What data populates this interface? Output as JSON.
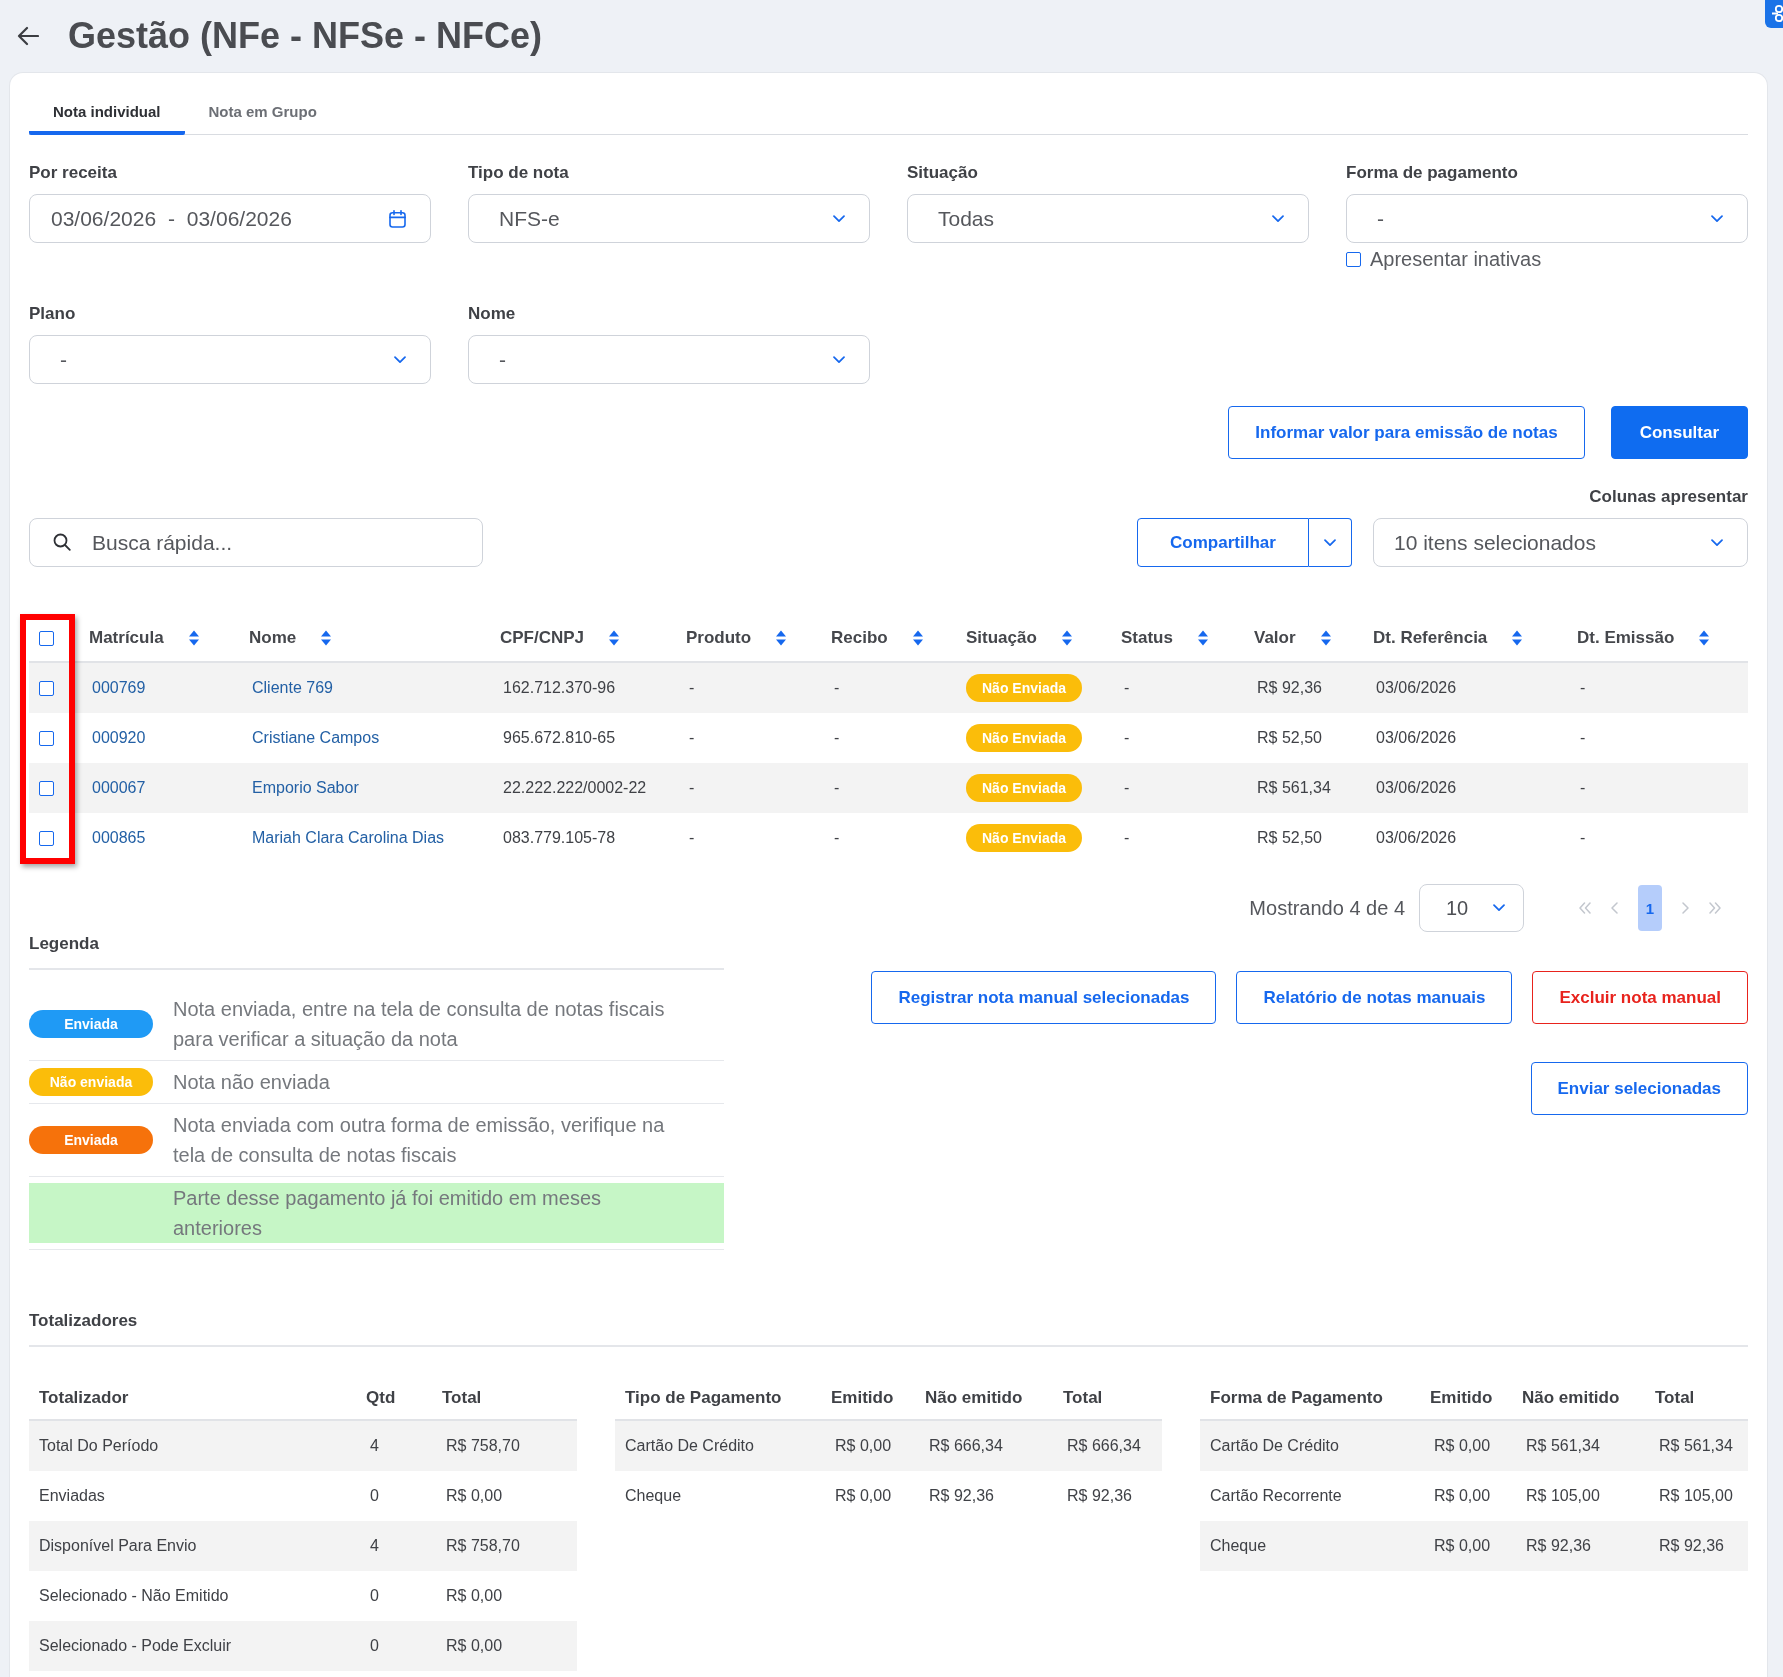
{
  "header": {
    "title": "Gestão (NFe - NFSe - NFCe)"
  },
  "tabs": [
    {
      "label": "Nota individual",
      "selected": true
    },
    {
      "label": "Nota em Grupo",
      "selected": false
    }
  ],
  "filters": [
    {
      "kind": "date-range",
      "label": "Por receita",
      "value": "03/06/2026 - 03/06/2026"
    },
    {
      "kind": "select",
      "label": "Tipo de nota",
      "value": "NFS-e"
    },
    {
      "kind": "select",
      "label": "Situação",
      "value": "Todas"
    },
    {
      "kind": "select",
      "label": "Forma de pagamento",
      "value": "-",
      "checkbox": {
        "label": "Apresentar inativas",
        "checked": false
      }
    },
    {
      "kind": "select",
      "label": "Plano",
      "value": "-"
    },
    {
      "kind": "select",
      "label": "Nome",
      "value": "-"
    }
  ],
  "actions": [
    {
      "label": "Informar valor para emissão de notas",
      "kind": "outline"
    },
    {
      "label": "Consultar",
      "kind": "primary"
    }
  ],
  "toolbar": {
    "columns_label": "Colunas apresentar",
    "search": {
      "placeholder": "Busca rápida..."
    },
    "share_button": "Compartilhar",
    "columns_select": "10 itens selecionados"
  },
  "table": {
    "checkbox_column_highlighted": true,
    "select_all": {
      "checked": false
    },
    "columns": [
      {
        "label": "Matrícula",
        "sortable": true
      },
      {
        "label": "Nome",
        "sortable": true
      },
      {
        "label": "CPF/CNPJ",
        "sortable": true
      },
      {
        "label": "Produto",
        "sortable": true
      },
      {
        "label": "Recibo",
        "sortable": true
      },
      {
        "label": "Situação",
        "sortable": true
      },
      {
        "label": "Status",
        "sortable": true
      },
      {
        "label": "Valor",
        "sortable": true
      },
      {
        "label": "Dt. Referência",
        "sortable": true
      },
      {
        "label": "Dt. Emissão",
        "sortable": true
      }
    ],
    "rows": [
      {
        "checked": false,
        "matricula": "000769",
        "nome": "Cliente 769",
        "cpf_cnpj": "162.712.370-96",
        "produto": "-",
        "recibo": "-",
        "situacao": {
          "label": "Não Enviada",
          "color": "#fbbd0a"
        },
        "status": "-",
        "valor": "R$ 92,36",
        "dt_referencia": "03/06/2026",
        "dt_emissao": "-"
      },
      {
        "checked": false,
        "matricula": "000920",
        "nome": "Cristiane Campos",
        "cpf_cnpj": "965.672.810-65",
        "produto": "-",
        "recibo": "-",
        "situacao": {
          "label": "Não Enviada",
          "color": "#fbbd0a"
        },
        "status": "-",
        "valor": "R$ 52,50",
        "dt_referencia": "03/06/2026",
        "dt_emissao": "-"
      },
      {
        "checked": false,
        "matricula": "000067",
        "nome": "Emporio Sabor",
        "cpf_cnpj": "22.222.222/0002-22",
        "produto": "-",
        "recibo": "-",
        "situacao": {
          "label": "Não Enviada",
          "color": "#fbbd0a"
        },
        "status": "-",
        "valor": "R$ 561,34",
        "dt_referencia": "03/06/2026",
        "dt_emissao": "-"
      },
      {
        "checked": false,
        "matricula": "000865",
        "nome": "Mariah Clara Carolina Dias",
        "cpf_cnpj": "083.779.105-78",
        "produto": "-",
        "recibo": "-",
        "situacao": {
          "label": "Não Enviada",
          "color": "#fbbd0a"
        },
        "status": "-",
        "valor": "R$ 52,50",
        "dt_referencia": "03/06/2026",
        "dt_emissao": "-"
      }
    ]
  },
  "pagination": {
    "summary": "Mostrando 4 de 4",
    "page_size": "10",
    "nav_before": [
      {
        "kind": "first",
        "disabled": true
      },
      {
        "kind": "prev",
        "disabled": true
      }
    ],
    "pages": [
      {
        "label": "1",
        "selected": true
      }
    ],
    "nav_after": [
      {
        "kind": "next",
        "disabled": true
      },
      {
        "kind": "last",
        "disabled": true
      }
    ]
  },
  "legend": {
    "title": "Legenda",
    "items": [
      {
        "kind": "badge",
        "badge": "Enviada",
        "color": "#1f9af5",
        "text": "Nota enviada, entre na tela de consulta de notas fiscais para verificar a situação da nota"
      },
      {
        "kind": "badge",
        "badge": "Não enviada",
        "color": "#fbbd0a",
        "text": "Nota não enviada"
      },
      {
        "kind": "badge",
        "badge": "Enviada",
        "color": "#f6720b",
        "text": "Nota enviada com outra forma de emissão, verifique na tela de consulta de notas fiscais"
      },
      {
        "kind": "highlight",
        "color": "#c6f6c6",
        "text": "Parte desse pagamento já foi emitido em meses anteriores"
      }
    ]
  },
  "note_actions": [
    {
      "buttons": [
        {
          "label": "Registrar nota manual selecionadas",
          "kind": "outline"
        },
        {
          "label": "Relatório de notas manuais",
          "kind": "outline"
        },
        {
          "label": "Excluir nota manual",
          "kind": "danger"
        }
      ]
    },
    {
      "buttons": [
        {
          "label": "Enviar selecionadas",
          "kind": "outline"
        }
      ]
    }
  ],
  "totals": {
    "title": "Totalizadores",
    "tables": [
      {
        "columns": [
          "Totalizador",
          "Qtd",
          "Total"
        ],
        "rows": [
          [
            "Total Do Período",
            "4",
            "R$ 758,70"
          ],
          [
            "Enviadas",
            "0",
            "R$ 0,00"
          ],
          [
            "Disponível Para Envio",
            "4",
            "R$ 758,70"
          ],
          [
            "Selecionado - Não Emitido",
            "0",
            "R$ 0,00"
          ],
          [
            "Selecionado - Pode Excluir",
            "0",
            "R$ 0,00"
          ]
        ]
      },
      {
        "columns": [
          "Tipo de Pagamento",
          "Emitido",
          "Não emitido",
          "Total"
        ],
        "rows": [
          [
            "Cartão De Crédito",
            "R$ 0,00",
            "R$ 666,34",
            "R$ 666,34"
          ],
          [
            "Cheque",
            "R$ 0,00",
            "R$ 92,36",
            "R$ 92,36"
          ]
        ]
      },
      {
        "columns": [
          "Forma de Pagamento",
          "Emitido",
          "Não emitido",
          "Total"
        ],
        "rows": [
          [
            "Cartão De Crédito",
            "R$ 0,00",
            "R$ 561,34",
            "R$ 561,34"
          ],
          [
            "Cartão Recorrente",
            "R$ 0,00",
            "R$ 105,00",
            "R$ 105,00"
          ],
          [
            "Cheque",
            "R$ 0,00",
            "R$ 92,36",
            "R$ 92,36"
          ]
        ]
      }
    ]
  }
}
